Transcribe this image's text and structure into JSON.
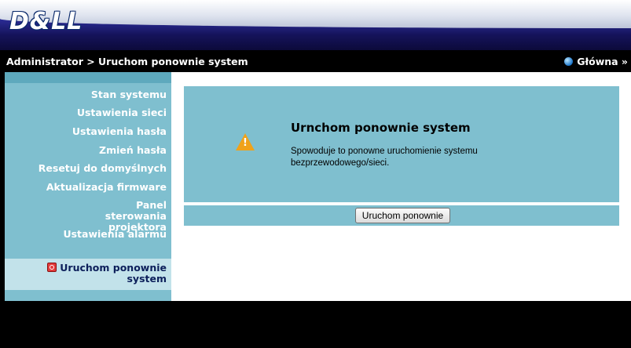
{
  "brand": {
    "logo_text": "D&LL"
  },
  "breadcrumb": {
    "text": "Administrator > Uruchom ponownie system"
  },
  "home_link": {
    "label": "Główna »"
  },
  "sidebar": {
    "items": [
      {
        "label": "Stan systemu"
      },
      {
        "label": "Ustawienia sieci"
      },
      {
        "label": "Ustawienia hasła"
      },
      {
        "label": "Zmień hasła"
      },
      {
        "label": "Resetuj do domyślnych"
      },
      {
        "label": "Aktualizacja firmware"
      },
      {
        "label": "Panel sterowania projektora"
      },
      {
        "label": "Ustawienia alarmu"
      }
    ],
    "active": {
      "label_line1": "Uruchom ponownie",
      "label_line2": "system"
    }
  },
  "main": {
    "title": "Urnchom ponownie system",
    "description": "Spowoduje to ponowne uruchomienie systemu bezprzewodowego/sieci.",
    "restart_button": "Uruchom ponownie"
  },
  "icons": {
    "home": "globe-icon",
    "warning": "warning-icon",
    "active_item": "restart-icon"
  },
  "colors": {
    "sidebar_bg": "#7fbfcf",
    "active_bg": "#c2e2ea",
    "header_bg": "#1d1a6a",
    "warning": "#f0a21a"
  }
}
